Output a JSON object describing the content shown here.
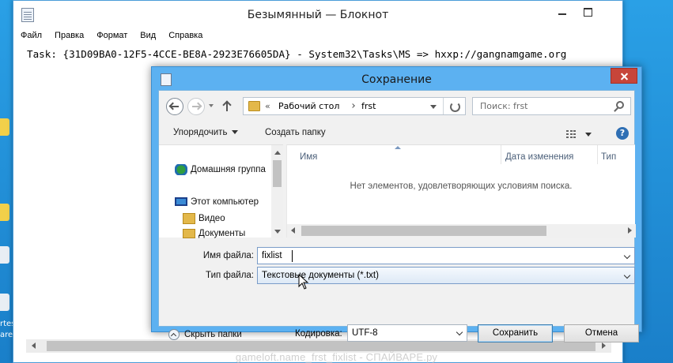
{
  "notepad": {
    "title": "Безымянный — Блокнот",
    "menu": [
      "Файл",
      "Правка",
      "Формат",
      "Вид",
      "Справка"
    ],
    "content": "Task: {31D09BA0-12F5-4CCE-BE8A-2923E76605DA} - System32\\Tasks\\MS => hxxp://gangnamgame.org"
  },
  "desktop": {
    "texts": [
      "rtes",
      "are"
    ]
  },
  "dialog": {
    "title": "Сохранение",
    "address": {
      "sep0": "«",
      "crumb1": "Рабочий стол",
      "crumb2": "frst"
    },
    "search_placeholder": "Поиск: frst",
    "toolbar": {
      "organize": "Упорядочить",
      "new_folder": "Создать папку",
      "help": "?"
    },
    "navpane": {
      "items": [
        {
          "label": "Домашняя группа",
          "icon": "homegroup-icon"
        },
        {
          "label": "Этот компьютер",
          "icon": "computer-icon"
        },
        {
          "label": "Видео",
          "icon": "folder-icon"
        },
        {
          "label": "Документы",
          "icon": "folder-icon"
        }
      ]
    },
    "columns": {
      "name": "Имя",
      "date": "Дата изменения",
      "type": "Тип"
    },
    "empty_message": "Нет элементов, удовлетворяющих условиям поиска.",
    "filename_label": "Имя файла:",
    "filename_value": "fixlist",
    "filetype_label": "Тип файла:",
    "filetype_value": "Текстовые документы (*.txt)",
    "hide_folders": "Скрыть папки",
    "encoding_label": "Кодировка:",
    "encoding_value": "UTF-8",
    "save_button": "Сохранить",
    "cancel_button": "Отмена"
  },
  "watermark": "gameloft.name_frst_fixlist - СПАЙВАРЕ.ру",
  "colors": {
    "desktop_blue": "#1a8fd6",
    "dialog_frame": "#5cb1f1",
    "close_red": "#c7453a"
  }
}
